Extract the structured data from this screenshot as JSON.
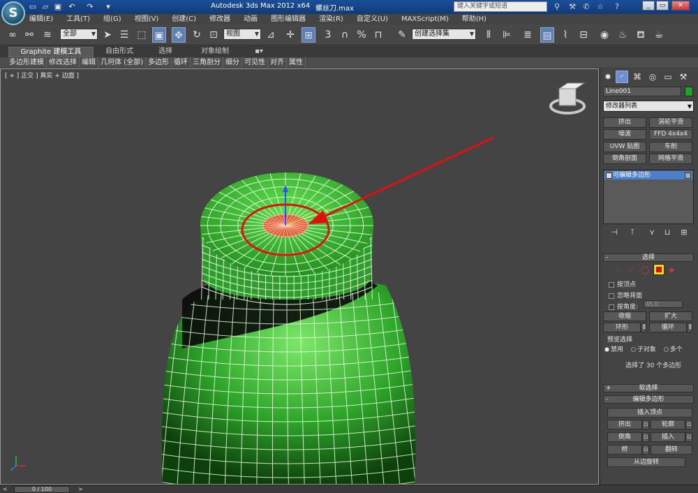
{
  "title_bar": {
    "app_logo": "S",
    "title": "Autodesk 3ds Max  2012 x64",
    "file": "螺丝刀.max",
    "search_placeholder": "键入关键字或短语"
  },
  "menu": [
    "编辑(E)",
    "工具(T)",
    "组(G)",
    "视图(V)",
    "创建(C)",
    "修改器",
    "动画",
    "图形编辑器",
    "渲染(R)",
    "自定义(U)",
    "MAXScript(M)",
    "帮助(H)"
  ],
  "toolbar": {
    "selection_filter": "全部",
    "reference_coord": "视图",
    "snap_3": "3",
    "percent": "%",
    "named_selection": "创建选择集"
  },
  "ribbon": {
    "tabs": [
      "Graphite 建模工具",
      "自由形式",
      "选择",
      "对象绘制"
    ],
    "sub_items": [
      "多边形建模",
      "修改选择",
      "编辑",
      "几何体 (全部)",
      "多边形",
      "循环",
      "三角剖分",
      "细分",
      "可见性",
      "对齐",
      "属性"
    ]
  },
  "viewport": {
    "label": "[ + ] 正交 ] 真实 + 边面 ]"
  },
  "command_panel": {
    "object_name": "Line001",
    "object_color": "#1fa329",
    "modifier_list": "修改器列表",
    "modifier_buttons": [
      "挤出",
      "涡轮平滑",
      "噪波",
      "FFD 4x4x4",
      "UVW 贴图",
      "车削",
      "倒角剖面",
      "网格平滑"
    ],
    "stack_item": "可编辑多边形",
    "selection": {
      "header": "选择",
      "by_vertex": "按顶点",
      "ignore_backface": "忽略背面",
      "by_angle": "按角度:",
      "angle_value": "45.0",
      "shrink": "收缩",
      "grow": "扩大",
      "ring": "环形",
      "loop": "循环",
      "preview_label": "预览选择",
      "preview_options": [
        "禁用",
        "子对象",
        "多个"
      ],
      "info": "选择了 30 个多边形"
    },
    "soft_selection": "软选择",
    "edit_polygons": {
      "header": "编辑多边形",
      "insert_vertex": "插入顶点",
      "extrude": "挤出",
      "outline": "轮廓",
      "bevel": "倒角",
      "inset": "插入",
      "bridge": "桥",
      "flip": "翻转",
      "hinge": "从边旋转"
    }
  },
  "timeline": {
    "slider": "0 / 100",
    "prev": "<",
    "next": ">"
  }
}
